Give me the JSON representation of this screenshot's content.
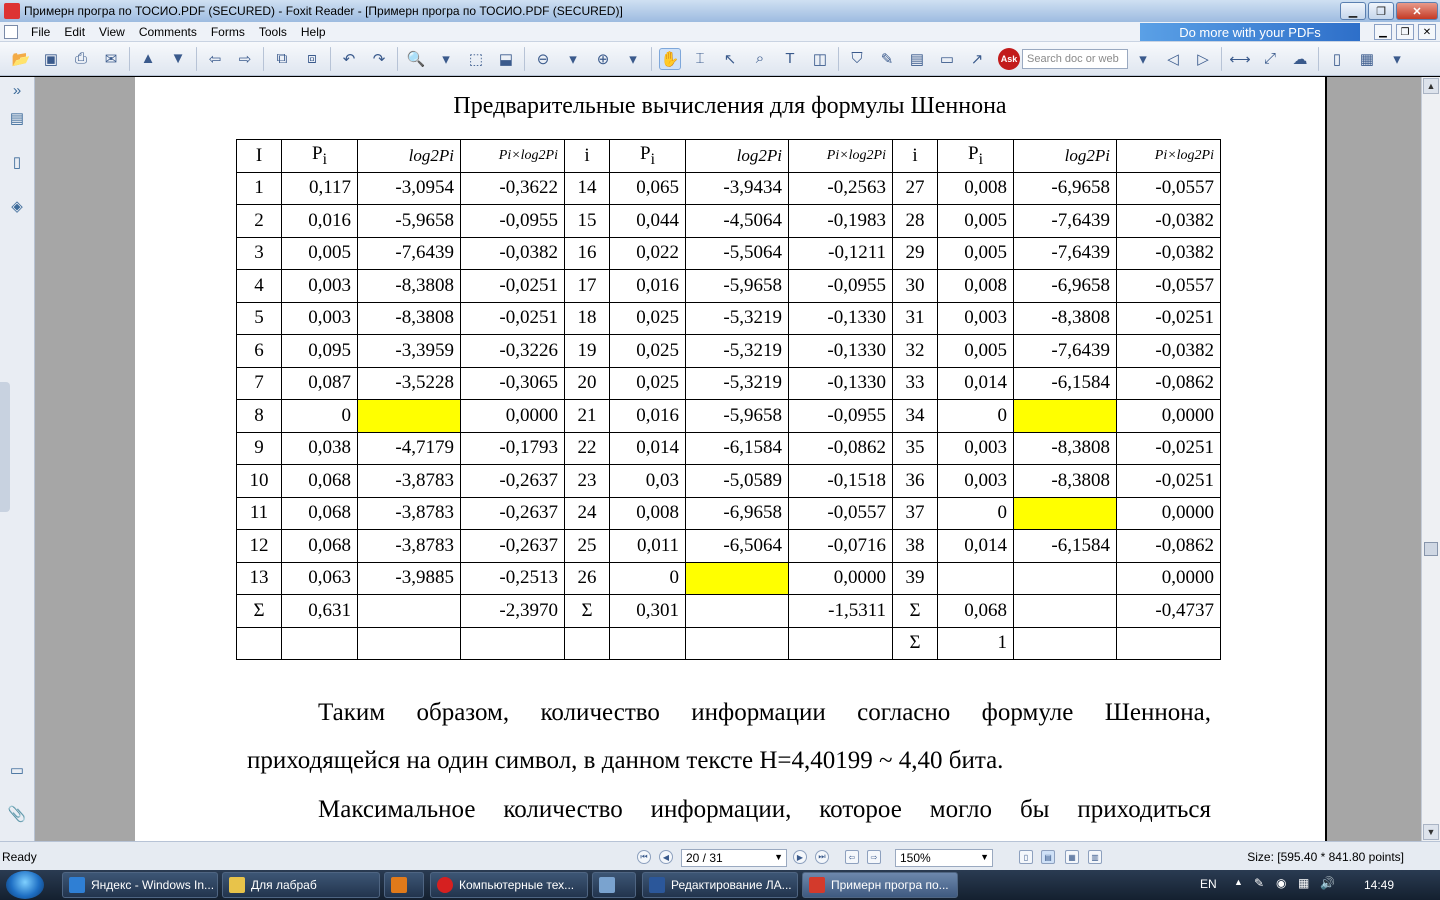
{
  "window": {
    "title": "Примерн програ по ТОСИО.PDF (SECURED) - Foxit Reader - [Примерн програ по ТОСИО.PDF (SECURED)]"
  },
  "menu": [
    "File",
    "Edit",
    "View",
    "Comments",
    "Forms",
    "Tools",
    "Help"
  ],
  "ad": {
    "label": "Do more with your PDFs"
  },
  "toolbar": {
    "search_placeholder": "Search doc or web",
    "ask_label": "Ask"
  },
  "document": {
    "table_title": "Предварительные вычисления для формулы Шеннона",
    "header": [
      "I",
      "P",
      "log2Pi",
      "Pi×log2Pi",
      "i",
      "P",
      "log2Pi",
      "Pi×log2Pi",
      "i",
      "P",
      "log2Pi",
      "Pi×log2Pi"
    ],
    "header_sub": "i",
    "rows": [
      [
        "1",
        "0,117",
        "-3,0954",
        "-0,3622",
        "14",
        "0,065",
        "-3,9434",
        "-0,2563",
        "27",
        "0,008",
        "-6,9658",
        "-0,0557"
      ],
      [
        "2",
        "0,016",
        "-5,9658",
        "-0,0955",
        "15",
        "0,044",
        "-4,5064",
        "-0,1983",
        "28",
        "0,005",
        "-7,6439",
        "-0,0382"
      ],
      [
        "3",
        "0,005",
        "-7,6439",
        "-0,0382",
        "16",
        "0,022",
        "-5,5064",
        "-0,1211",
        "29",
        "0,005",
        "-7,6439",
        "-0,0382"
      ],
      [
        "4",
        "0,003",
        "-8,3808",
        "-0,0251",
        "17",
        "0,016",
        "-5,9658",
        "-0,0955",
        "30",
        "0,008",
        "-6,9658",
        "-0,0557"
      ],
      [
        "5",
        "0,003",
        "-8,3808",
        "-0,0251",
        "18",
        "0,025",
        "-5,3219",
        "-0,1330",
        "31",
        "0,003",
        "-8,3808",
        "-0,0251"
      ],
      [
        "6",
        "0,095",
        "-3,3959",
        "-0,3226",
        "19",
        "0,025",
        "-5,3219",
        "-0,1330",
        "32",
        "0,005",
        "-7,6439",
        "-0,0382"
      ],
      [
        "7",
        "0,087",
        "-3,5228",
        "-0,3065",
        "20",
        "0,025",
        "-5,3219",
        "-0,1330",
        "33",
        "0,014",
        "-6,1584",
        "-0,0862"
      ],
      [
        "8",
        "0",
        "",
        "0,0000",
        "21",
        "0,016",
        "-5,9658",
        "-0,0955",
        "34",
        "0",
        "",
        "0,0000"
      ],
      [
        "9",
        "0,038",
        "-4,7179",
        "-0,1793",
        "22",
        "0,014",
        "-6,1584",
        "-0,0862",
        "35",
        "0,003",
        "-8,3808",
        "-0,0251"
      ],
      [
        "10",
        "0,068",
        "-3,8783",
        "-0,2637",
        "23",
        "0,03",
        "-5,0589",
        "-0,1518",
        "36",
        "0,003",
        "-8,3808",
        "-0,0251"
      ],
      [
        "11",
        "0,068",
        "-3,8783",
        "-0,2637",
        "24",
        "0,008",
        "-6,9658",
        "-0,0557",
        "37",
        "0",
        "",
        "0,0000"
      ],
      [
        "12",
        "0,068",
        "-3,8783",
        "-0,2637",
        "25",
        "0,011",
        "-6,5064",
        "-0,0716",
        "38",
        "0,014",
        "-6,1584",
        "-0,0862"
      ],
      [
        "13",
        "0,063",
        "-3,9885",
        "-0,2513",
        "26",
        "0",
        "",
        "0,0000",
        "39",
        "",
        "",
        "0,0000"
      ],
      [
        "Σ",
        "0,631",
        "",
        "-2,3970",
        "Σ",
        "0,301",
        "",
        "-1,5311",
        "Σ",
        "0,068",
        "",
        "-0,4737"
      ],
      [
        "",
        "",
        "",
        "",
        "",
        "",
        "",
        "",
        "Σ",
        "1",
        "",
        ""
      ]
    ],
    "yellow_cells": [
      "7-2",
      "7-10",
      "10-10",
      "12-6"
    ],
    "paragraph1_line1": "Таким образом, количество информации согласно формуле Шеннона,",
    "paragraph1_line2": "приходящейся на один символ, в данном тексте H=4,40199 ~ 4,40 бита.",
    "paragraph2_line1": "Максимальное количество информации, которое могло бы приходиться"
  },
  "status": {
    "ready": "Ready",
    "page": "20 / 31",
    "zoom": "150%",
    "size": "Size: [595.40 * 841.80 points]"
  },
  "taskbar": {
    "tasks": [
      {
        "label": "Яндекс - Windows In...",
        "color": "#2f7fd4"
      },
      {
        "label": "Для лабраб",
        "color": "#e8c34a"
      },
      {
        "label": "",
        "color": "#e07a1a"
      },
      {
        "label": "Компьютерные тех...",
        "color": "#d62020"
      },
      {
        "label": "",
        "color": "#7aa3cf"
      },
      {
        "label": "Редактирование ЛА...",
        "color": "#2b579a"
      },
      {
        "label": "Примерн програ по...",
        "color": "#d33a2c"
      }
    ],
    "lang": "EN",
    "time": "14:49"
  }
}
